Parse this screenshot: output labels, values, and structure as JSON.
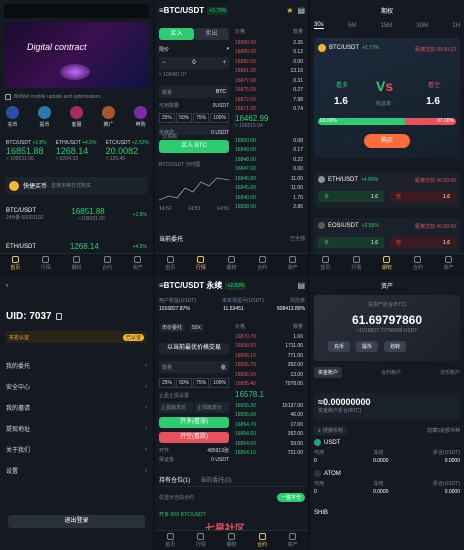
{
  "home": {
    "banner_title": "Digital contract",
    "notice": "BitWell mobile update and optimisation...",
    "shortcuts": [
      {
        "label": "充币",
        "icon": "deposit-icon"
      },
      {
        "label": "提币",
        "icon": "withdraw-icon"
      },
      {
        "label": "客服",
        "icon": "service-icon"
      },
      {
        "label": "推广",
        "icon": "promo-icon"
      },
      {
        "label": "申购",
        "icon": "subscribe-icon"
      }
    ],
    "tickers": [
      {
        "pair": "BTC/USDT",
        "change": "+2.8%",
        "price": "16851.88",
        "cny": "≈ 109031.66"
      },
      {
        "pair": "ETH/USDT",
        "change": "+4.5%",
        "price": "1268.14",
        "cny": "≈ 8204.33"
      },
      {
        "pair": "ETC/USDT",
        "change": "+2.52%",
        "price": "20.0082",
        "cny": "≈ 129.45"
      }
    ],
    "quick_buy": "快捷买币",
    "quick_buy_sub": "支持多种方式购买",
    "list": [
      {
        "pair": "BTC/USDT",
        "vol": "24H量 60001102",
        "price": "16851.88",
        "cny": "≈109031.66",
        "change": "+2.8%"
      },
      {
        "pair": "ETH/USDT",
        "vol": "",
        "price": "1268.14",
        "cny": "",
        "change": "+4.5%"
      }
    ],
    "tabs": [
      "首页",
      "行情",
      "期权",
      "合约",
      "资产"
    ]
  },
  "trade": {
    "pair": "≡BTC/USDT",
    "change": "+2.79%",
    "buy_tab": "买入",
    "sell_tab": "卖出",
    "order_type": "限价",
    "price": "0",
    "cny": "≈ 106487.07",
    "qty_placeholder": "数量",
    "qty_unit": "BTC",
    "avail_label": "可用数量",
    "avail_val": "0USDT",
    "percents": [
      "25%",
      "50%",
      "75%",
      "100%"
    ],
    "amount_label": "交易额",
    "amount_val": "≈ 106515.54",
    "fee_label": "手续费:",
    "fee_val": "0 USDT",
    "buy_btn": "买入 BTC",
    "chart_label": "BTC/USDT 分时图",
    "book_header": [
      "价格",
      "数量"
    ],
    "asks": [
      [
        "16890.00",
        "2.35"
      ],
      [
        "16880.00",
        "0.12"
      ],
      [
        "16882.00",
        "0.00"
      ],
      [
        "16881.00",
        "13.16"
      ],
      [
        "16877.00",
        "0.31"
      ],
      [
        "16875.00",
        "0.27"
      ],
      [
        "16872.00",
        "7.98"
      ],
      [
        "16871.00",
        "0.74"
      ]
    ],
    "mid": "16462.99",
    "mid_cny": "≈ 106515.54",
    "bids": [
      [
        "16850.00",
        "0.08"
      ],
      [
        "16849.00",
        "0.17"
      ],
      [
        "16848.00",
        "0.22"
      ],
      [
        "16847.00",
        "0.00"
      ],
      [
        "16846.00",
        "11.00"
      ],
      [
        "16845.00",
        "11.00"
      ],
      [
        "16840.00",
        "1.70"
      ],
      [
        "16838.00",
        "2.86"
      ]
    ],
    "times": [
      "14:52",
      "14:53",
      "14:55"
    ],
    "current_orders": "当前委托",
    "all_orders": "已全部",
    "tabs": [
      "首页",
      "行情",
      "期权",
      "合约",
      "资产"
    ]
  },
  "options": {
    "title": "期权",
    "periods": [
      "30s",
      "5M",
      "15M",
      "30M",
      "1H"
    ],
    "pair": "BTC/USDT",
    "change": "+2.77%",
    "countdown": "距离交割 00:00:22",
    "bull_label": "看多",
    "bear_label": "看空",
    "bull_val": "1.6",
    "bear_val": "1.6",
    "rate_label": "收益率",
    "bar_left": "63.00%",
    "bar_right": "37.00%",
    "buy_btn": "购买",
    "others": [
      {
        "pair": "ETH/USDT",
        "change": "+4.89%",
        "countdown": "距离交割 00:00:55",
        "bull": "多",
        "bear": "空",
        "val_l": "1.6",
        "val_r": "1.6"
      },
      {
        "pair": "EOS/USDT",
        "change": "+2.55%",
        "countdown": "距离交割 00:00:55",
        "bull": "多",
        "bear": "空",
        "val_l": "1.6",
        "val_r": "1.6"
      }
    ],
    "tabs": [
      "首页",
      "行情",
      "期权",
      "合约",
      "资产"
    ]
  },
  "profile": {
    "uid": "UID: 7037",
    "verify": "实名认证",
    "badge": "已认证",
    "menu": [
      "我的委托",
      "安全中心",
      "我的邀请",
      "提现地址",
      "关于我们",
      "设置"
    ],
    "logout": "退出登录"
  },
  "contract": {
    "pair": "≡BTC/USDT 永续",
    "change": "+2.83%",
    "h1": "用户权益(USDT)",
    "h2": "未实现盈亏(USDT)",
    "h3": "风险率",
    "v1": "1016827.87%",
    "v2": "11.53451",
    "v3": "508413.89%",
    "order_type": "市价委托",
    "lever": "50X",
    "price_hint": "以当前最优价格交易",
    "book_header": [
      "价格",
      "数量"
    ],
    "asks": [
      [
        "16870.70",
        "1.00"
      ],
      [
        "16858.50",
        "1711.00"
      ],
      [
        "16856.10",
        "771.00"
      ],
      [
        "16855.70",
        "392.00"
      ],
      [
        "16855.50",
        "13.00"
      ],
      [
        "16855.40",
        "7078.00"
      ]
    ],
    "mid": "16578.1",
    "bids": [
      [
        "16855.30",
        "15137.00"
      ],
      [
        "16855.00",
        "46.00"
      ],
      [
        "16854.70",
        "17.00"
      ],
      [
        "16854.60",
        "392.00"
      ],
      [
        "16854.50",
        "59.00"
      ],
      [
        "16854.10",
        "721.00"
      ]
    ],
    "qty_placeholder": "数量",
    "qty_unit": "张",
    "percents": [
      "25%",
      "50%",
      "75%",
      "100%"
    ],
    "stop_label": "止盈止损设置",
    "tp": "止盈触发价",
    "sl": "止损触发价",
    "long_btn": "开多(看涨)",
    "short_btn": "开空(看跌)",
    "avail": "可开",
    "avail_val": "485913张",
    "margin": "保证金",
    "margin_val": "0 USDT",
    "pos_tab": "持有仓位(1)",
    "order_tab": "当前委托(0)",
    "only_label": "仅显示当前合约",
    "close_all": "一键平仓",
    "pos_line": "开多 50X BTC/USDT",
    "watermark": "七星社区",
    "tabs": [
      "首页",
      "行情",
      "期权",
      "合约",
      "资产"
    ]
  },
  "assets": {
    "title": "资产",
    "total_label": "总资产折合(BTC)",
    "total": "61.69797860",
    "total_cny": "≈1016827.72700000 USDT",
    "actions": [
      "充币",
      "提币",
      "划转"
    ],
    "acct_tabs": [
      "资金账户",
      "合约账户",
      "法币账户"
    ],
    "acct_total": "≈0.00000000",
    "acct_total_label": "资金账户折合(BTC)",
    "search": "搜索币种",
    "hide_small": "隐藏0余额币种",
    "coins": [
      {
        "name": "USDT",
        "cols": [
          "可用",
          "冻结",
          "折合(USDT)"
        ],
        "vals": [
          "0",
          "0.0000",
          "0.0000"
        ]
      },
      {
        "name": "ATOM",
        "cols": [
          "可用",
          "冻结",
          "折合(USDT)"
        ],
        "vals": [
          "0",
          "0.0000",
          "0.0000"
        ]
      },
      {
        "name": "SHIB",
        "cols": [],
        "vals": []
      }
    ],
    "tabs": [
      "首页",
      "行情",
      "期权",
      "合约",
      "资产"
    ]
  },
  "colors": {
    "green": "#2ecc71",
    "red": "#e8505b",
    "yellow": "#f2b630",
    "bg": "#151a22"
  }
}
